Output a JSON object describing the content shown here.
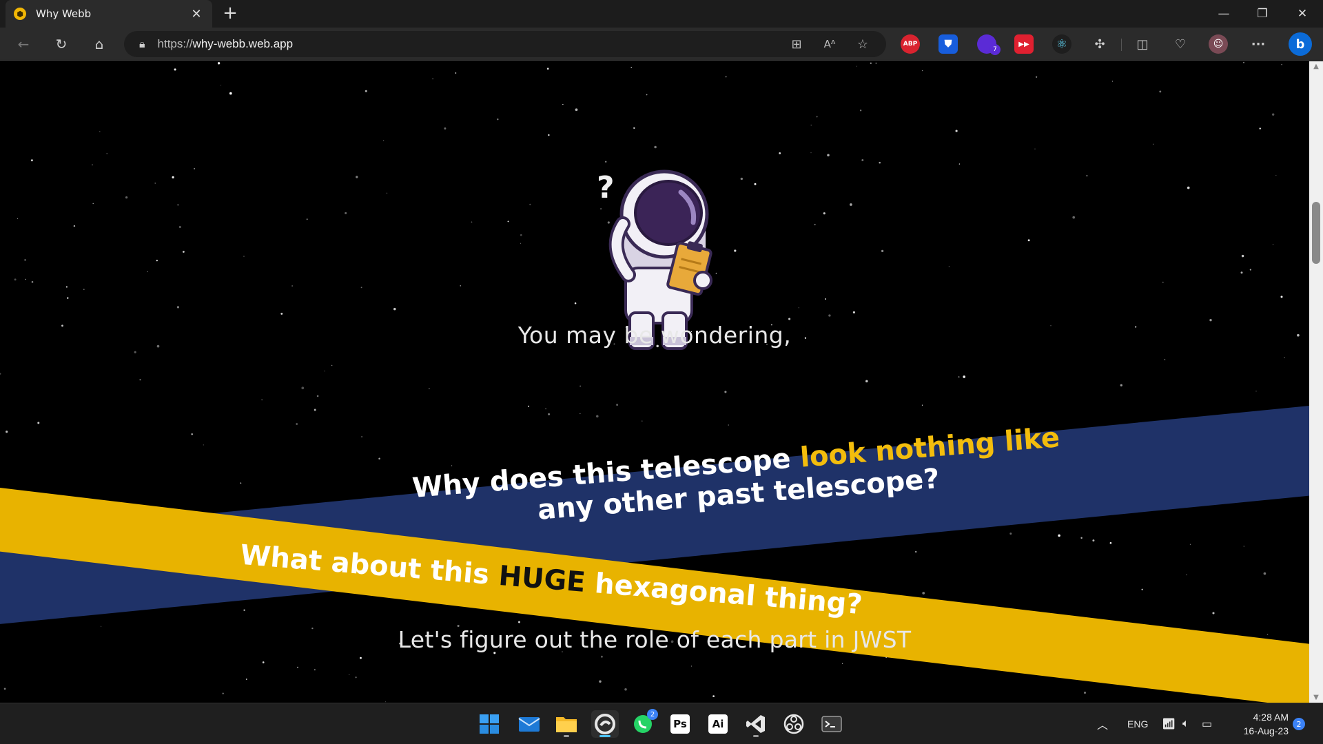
{
  "browser": {
    "tab_title": "Why Webb",
    "tab_close": "✕",
    "new_tab": "+",
    "url_prefix": "https://",
    "url_host": "why-webb.web.app",
    "window_minimize": "—",
    "window_restore": "❐",
    "window_close": "✕",
    "ext_abp": "ABP",
    "ext_badge": "7",
    "menu": "···"
  },
  "page": {
    "intro": "You may be wondering,",
    "q1_part1": "Why does this telescope ",
    "q1_highlight": "look nothing like",
    "q1_part2": "any other past telescope?",
    "q2_part1": "What about this ",
    "q2_highlight": "HUGE",
    "q2_part2": " hexagonal thing?",
    "outro": "Let's figure out the role of each part in JWST",
    "colors": {
      "blue_band": "#1f3268",
      "yellow_band": "#e8b300",
      "highlight_yellow": "#f3bd0c"
    }
  },
  "taskbar": {
    "apps": [
      {
        "name": "start",
        "icon": "windows-logo-icon"
      },
      {
        "name": "mail",
        "icon": "mail-icon"
      },
      {
        "name": "file-explorer",
        "icon": "folder-icon"
      },
      {
        "name": "edge",
        "icon": "edge-icon"
      },
      {
        "name": "whatsapp",
        "icon": "whatsapp-icon",
        "badge": "2"
      },
      {
        "name": "photoshop",
        "label": "Ps"
      },
      {
        "name": "illustrator",
        "label": "Ai"
      },
      {
        "name": "vscode",
        "icon": "vscode-icon"
      },
      {
        "name": "obs",
        "icon": "obs-icon"
      },
      {
        "name": "terminal",
        "icon": "terminal-icon"
      }
    ],
    "language": "ENG",
    "time": "4:28 AM",
    "date": "16-Aug-23",
    "notifications": "2"
  }
}
